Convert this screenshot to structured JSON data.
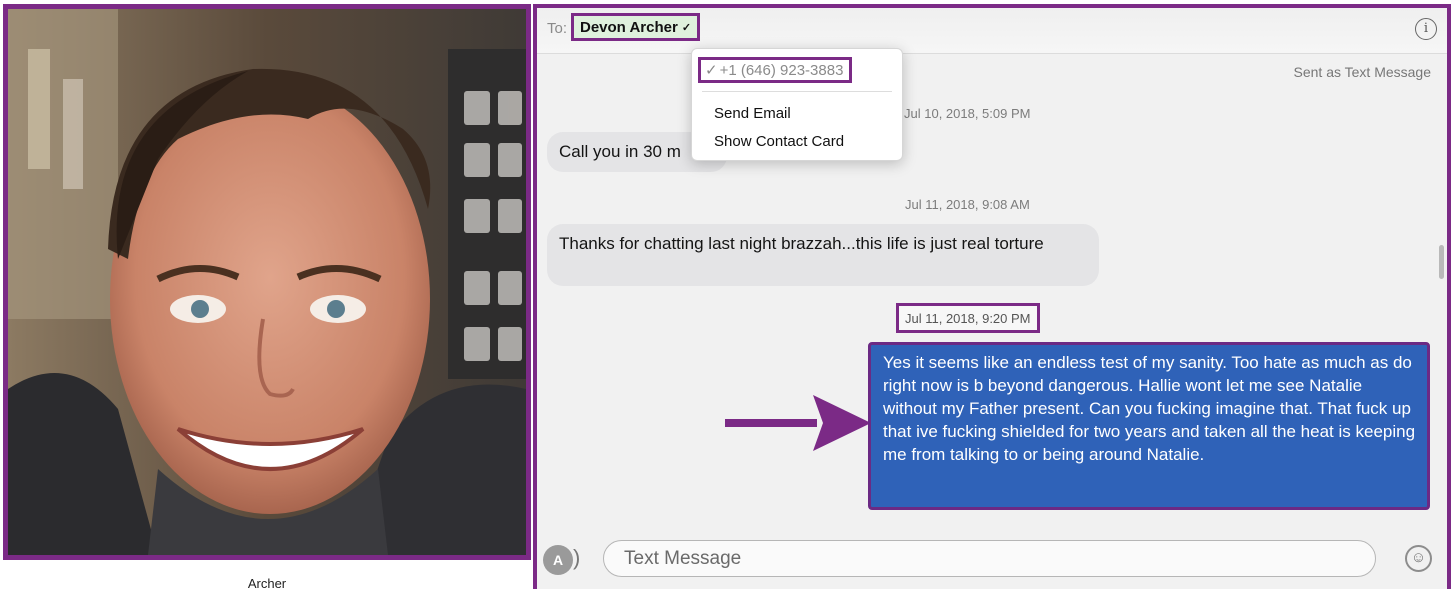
{
  "photo": {
    "caption": "Archer"
  },
  "conversation": {
    "to_label": "To:",
    "recipient": "Devon Archer",
    "info_icon": "info-icon",
    "sent_as": "Sent as Text Message",
    "menu": {
      "phone": "+1 (646) 923-3883",
      "items": [
        "Send Email",
        "Show Contact Card"
      ]
    },
    "messages": [
      {
        "timestamp": "Jul 10, 2018, 5:09 PM",
        "direction": "incoming",
        "text": "Call you in 30 m"
      },
      {
        "timestamp": "Jul 11, 2018, 9:08 AM",
        "direction": "incoming",
        "text": "Thanks for chatting last night brazzah...this life is just real torture"
      },
      {
        "timestamp": "Jul 11, 2018, 9:20 PM",
        "direction": "outgoing",
        "text": "Yes it seems like an endless test of my sanity.  Too hate as much as do right now is b beyond dangerous.  Hallie wont let me see Natalie without my Father present.  Can you fucking imagine that. That fuck up that ive fucking shielded for two years and taken all the heat is  keeping me from talking to or being around Natalie."
      }
    ],
    "input_placeholder": "Text Message"
  },
  "colors": {
    "highlight_border": "#7b2a86",
    "outgoing_bubble": "#2f62b8",
    "incoming_bubble": "#e4e4e6",
    "recipient_bg": "#dff1dd"
  }
}
